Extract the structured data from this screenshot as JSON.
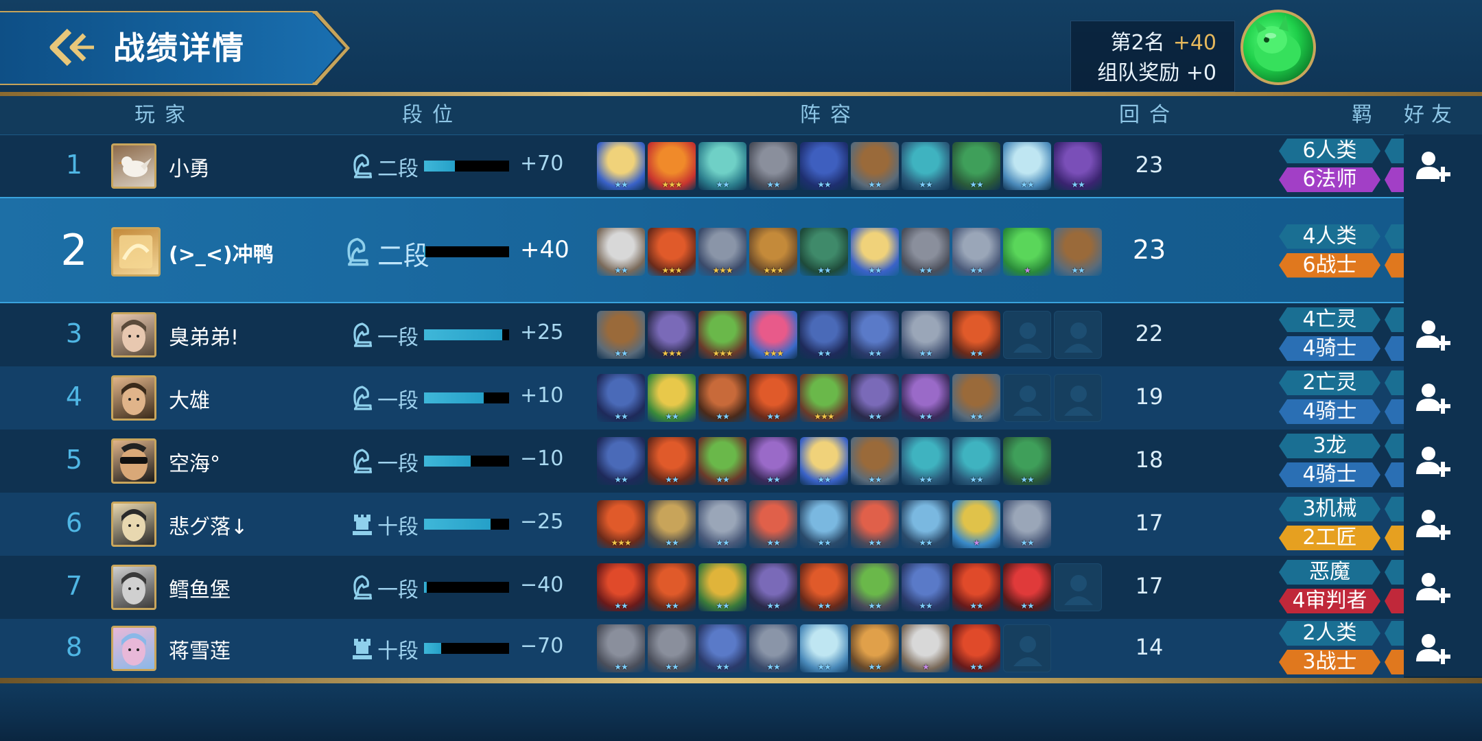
{
  "header": {
    "title": "战绩详情",
    "rank_label": "第2名",
    "rank_points": "+40",
    "team_reward_label": "组队奖励 +0"
  },
  "columns": {
    "player": "玩家",
    "tier": "段位",
    "lineup": "阵容",
    "rounds": "回合",
    "synergy": "羁绊",
    "friends": "好友"
  },
  "colors": {
    "accent_gold": "#c9a65c",
    "rank_blue": "#4fb6e4",
    "synergy_teal": "#1a6f93",
    "synergy_blue": "#2a6fb4",
    "synergy_purple": "#a23fc6",
    "synergy_orange": "#e0781e",
    "synergy_gold": "#e6a020",
    "synergy_red": "#c0283a"
  },
  "players": [
    {
      "rank": "1",
      "name": "小勇",
      "tier_icon": "knight-icon",
      "tier": "二段",
      "tier_progress": 0.36,
      "tier_delta": "+70",
      "rounds": "23",
      "avatar": "dove-avatar",
      "avatar_colors": [
        "#8d6a4a",
        "#d8cfc2"
      ],
      "friend": true,
      "synergies": [
        {
          "label": "6人类",
          "color": "#1a6f93"
        },
        {
          "label": "6法师",
          "color": "#a23fc6"
        }
      ],
      "units": [
        {
          "name": "unit-goddess",
          "stars": 2,
          "colors": [
            "#f0d27a",
            "#3a62c8"
          ]
        },
        {
          "name": "unit-sun-mage",
          "stars": 3,
          "colors": [
            "#f08a2a",
            "#c8352f"
          ]
        },
        {
          "name": "unit-elf-mage",
          "stars": 2,
          "colors": [
            "#6fd0c6",
            "#2b7d8c"
          ]
        },
        {
          "name": "unit-viking",
          "stars": 2,
          "colors": [
            "#8a8f9c",
            "#4a4e5a"
          ]
        },
        {
          "name": "unit-witch",
          "stars": 2,
          "colors": [
            "#3e5fbf",
            "#1e2f70"
          ]
        },
        {
          "name": "unit-cavalry",
          "stars": 2,
          "colors": [
            "#9a6a3a",
            "#5a6b7a"
          ]
        },
        {
          "name": "unit-dragon",
          "stars": 2,
          "colors": [
            "#3fb3c0",
            "#2a5a7a"
          ]
        },
        {
          "name": "unit-goblin-flyer",
          "stars": 2,
          "colors": [
            "#3f9f5a",
            "#2a5a3a"
          ]
        },
        {
          "name": "unit-ice-mage",
          "stars": 2,
          "colors": [
            "#bfe6f2",
            "#4a8aba"
          ]
        },
        {
          "name": "unit-void-mage",
          "stars": 2,
          "colors": [
            "#7a4fb8",
            "#3a2470"
          ]
        }
      ]
    },
    {
      "rank": "2",
      "name": "(>_<)冲鸭",
      "tier_icon": "knight-icon",
      "tier": "二段",
      "tier_progress": 0.02,
      "tier_delta": "+40",
      "rounds": "23",
      "avatar": "gold-avatar",
      "avatar_colors": [
        "#c48a3a",
        "#f3d79a"
      ],
      "friend": false,
      "me": true,
      "synergies": [
        {
          "label": "4人类",
          "color": "#1a6f93"
        },
        {
          "label": "6战士",
          "color": "#e0781e"
        }
      ],
      "units": [
        {
          "name": "unit-old-sage",
          "stars": 2,
          "colors": [
            "#d8d8d8",
            "#7a6a5a"
          ]
        },
        {
          "name": "unit-flame-warrior",
          "stars": 3,
          "colors": [
            "#e05a2a",
            "#6a2a1a"
          ]
        },
        {
          "name": "unit-armored-knight",
          "stars": 3,
          "colors": [
            "#8a95a8",
            "#3a4a6a"
          ]
        },
        {
          "name": "unit-treasure-gate",
          "stars": 3,
          "colors": [
            "#c48a3a",
            "#6a4a2a"
          ]
        },
        {
          "name": "unit-dragon-green",
          "stars": 2,
          "colors": [
            "#3f8a6a",
            "#1e4a3a"
          ]
        },
        {
          "name": "unit-goddess",
          "stars": 2,
          "colors": [
            "#f0d27a",
            "#3a62c8"
          ]
        },
        {
          "name": "unit-viking",
          "stars": 2,
          "colors": [
            "#8a8f9c",
            "#4a4e5a"
          ]
        },
        {
          "name": "unit-axe-knight",
          "stars": 2,
          "colors": [
            "#9aa6b8",
            "#4a5a7a"
          ]
        },
        {
          "name": "unit-green-ogre",
          "stars": 1,
          "colors": [
            "#5ad65a",
            "#2a8a3a"
          ]
        },
        {
          "name": "unit-cavalry",
          "stars": 2,
          "colors": [
            "#9a6a3a",
            "#5a6b7a"
          ]
        }
      ]
    },
    {
      "rank": "3",
      "name": "臭弟弟!",
      "tier_icon": "knight-icon",
      "tier": "一段",
      "tier_progress": 0.92,
      "tier_delta": "+25",
      "rounds": "22",
      "avatar": "portrait-avatar",
      "avatar_colors": [
        "#e8c8b0",
        "#5a4a3a"
      ],
      "friend": true,
      "synergies": [
        {
          "label": "4亡灵",
          "color": "#1a6f93"
        },
        {
          "label": "4骑士",
          "color": "#2a6fb4"
        }
      ],
      "units": [
        {
          "name": "unit-cavalry",
          "stars": 2,
          "colors": [
            "#9a6a3a",
            "#5a6b7a"
          ]
        },
        {
          "name": "unit-reaper",
          "stars": 3,
          "colors": [
            "#7a6ab8",
            "#2a2a4a"
          ]
        },
        {
          "name": "unit-goblin",
          "stars": 3,
          "colors": [
            "#6ab84a",
            "#6a3a2a"
          ]
        },
        {
          "name": "unit-shark",
          "stars": 3,
          "colors": [
            "#e85a8a",
            "#3a6ac8"
          ]
        },
        {
          "name": "unit-death-knight",
          "stars": 2,
          "colors": [
            "#4a6ab8",
            "#1e2a5a"
          ]
        },
        {
          "name": "unit-wraith",
          "stars": 2,
          "colors": [
            "#5a7ac8",
            "#2a3a6a"
          ]
        },
        {
          "name": "unit-axe-knight",
          "stars": 2,
          "colors": [
            "#9aa6b8",
            "#4a5a7a"
          ]
        },
        {
          "name": "unit-flame-warrior",
          "stars": 2,
          "colors": [
            "#e05a2a",
            "#6a2a1a"
          ]
        },
        {
          "name": "empty-slot",
          "stars": 0,
          "empty": true
        },
        {
          "name": "empty-slot",
          "stars": 0,
          "empty": true
        }
      ]
    },
    {
      "rank": "4",
      "name": "大雄",
      "tier_icon": "knight-icon",
      "tier": "一段",
      "tier_progress": 0.7,
      "tier_delta": "+10",
      "rounds": "19",
      "avatar": "portrait-avatar",
      "avatar_colors": [
        "#e0b48a",
        "#3a2a1a"
      ],
      "friend": true,
      "synergies": [
        {
          "label": "2亡灵",
          "color": "#1a6f93"
        },
        {
          "label": "4骑士",
          "color": "#2a6fb4"
        }
      ],
      "units": [
        {
          "name": "unit-death-knight",
          "stars": 2,
          "colors": [
            "#4a6ab8",
            "#1e2a5a"
          ]
        },
        {
          "name": "unit-elf-king",
          "stars": 2,
          "colors": [
            "#e8c84a",
            "#3a8a3a"
          ]
        },
        {
          "name": "unit-troll",
          "stars": 2,
          "colors": [
            "#c86a3a",
            "#4a2a1a"
          ]
        },
        {
          "name": "unit-flame-warrior",
          "stars": 2,
          "colors": [
            "#e05a2a",
            "#6a2a1a"
          ]
        },
        {
          "name": "unit-goblin",
          "stars": 3,
          "colors": [
            "#6ab84a",
            "#6a3a2a"
          ]
        },
        {
          "name": "unit-reaper",
          "stars": 2,
          "colors": [
            "#7a6ab8",
            "#2a2a4a"
          ]
        },
        {
          "name": "unit-witch-purple",
          "stars": 2,
          "colors": [
            "#9a6ac8",
            "#3a2a5a"
          ]
        },
        {
          "name": "unit-cavalry",
          "stars": 2,
          "colors": [
            "#9a6a3a",
            "#5a6b7a"
          ]
        },
        {
          "name": "empty-slot",
          "stars": 0,
          "empty": true
        },
        {
          "name": "empty-slot",
          "stars": 0,
          "empty": true
        }
      ]
    },
    {
      "rank": "5",
      "name": "空海°",
      "tier_icon": "knight-icon",
      "tier": "一段",
      "tier_progress": 0.55,
      "tier_delta": "−10",
      "rounds": "18",
      "avatar": "sunglasses-avatar",
      "avatar_colors": [
        "#e0b48a",
        "#1a1a1a"
      ],
      "friend": true,
      "synergies": [
        {
          "label": "3龙",
          "color": "#1a6f93"
        },
        {
          "label": "4骑士",
          "color": "#2a6fb4"
        }
      ],
      "units": [
        {
          "name": "unit-death-knight",
          "stars": 2,
          "colors": [
            "#4a6ab8",
            "#1e2a5a"
          ]
        },
        {
          "name": "unit-flame-warrior",
          "stars": 2,
          "colors": [
            "#e05a2a",
            "#6a2a1a"
          ]
        },
        {
          "name": "unit-goblin",
          "stars": 2,
          "colors": [
            "#6ab84a",
            "#6a3a2a"
          ]
        },
        {
          "name": "unit-witch-purple",
          "stars": 2,
          "colors": [
            "#9a6ac8",
            "#3a2a5a"
          ]
        },
        {
          "name": "unit-goddess",
          "stars": 2,
          "colors": [
            "#f0d27a",
            "#3a62c8"
          ]
        },
        {
          "name": "unit-cavalry",
          "stars": 2,
          "colors": [
            "#9a6a3a",
            "#5a6b7a"
          ]
        },
        {
          "name": "unit-dragon",
          "stars": 2,
          "colors": [
            "#3fb3c0",
            "#2a5a7a"
          ]
        },
        {
          "name": "unit-dragon",
          "stars": 2,
          "colors": [
            "#3fb3c0",
            "#2a5a7a"
          ]
        },
        {
          "name": "unit-goblin-flyer",
          "stars": 2,
          "colors": [
            "#3f9f5a",
            "#2a5a3a"
          ]
        },
        {
          "name": "empty-slot",
          "stars": 0,
          "hidden": true
        }
      ]
    },
    {
      "rank": "6",
      "name": "悲グ落↓",
      "tier_icon": "rook-icon",
      "tier": "十段",
      "tier_progress": 0.78,
      "tier_delta": "−25",
      "rounds": "17",
      "avatar": "portrait-avatar",
      "avatar_colors": [
        "#e8d8b0",
        "#2a2a2a"
      ],
      "friend": true,
      "synergies": [
        {
          "label": "3机械",
          "color": "#1a6f93"
        },
        {
          "label": "2工匠",
          "color": "#e6a020"
        }
      ],
      "units": [
        {
          "name": "unit-flame-warrior",
          "stars": 3,
          "colors": [
            "#e05a2a",
            "#6a2a1a"
          ]
        },
        {
          "name": "unit-mech-golem",
          "stars": 2,
          "colors": [
            "#c8a45a",
            "#4a4a4a"
          ]
        },
        {
          "name": "unit-axe-knight",
          "stars": 2,
          "colors": [
            "#9aa6b8",
            "#4a5a7a"
          ]
        },
        {
          "name": "unit-bomber",
          "stars": 2,
          "colors": [
            "#e0604a",
            "#4a4a5a"
          ]
        },
        {
          "name": "unit-blade-knight",
          "stars": 2,
          "colors": [
            "#7ab8e0",
            "#2a4a6a"
          ]
        },
        {
          "name": "unit-bomber",
          "stars": 2,
          "colors": [
            "#e0604a",
            "#4a4a5a"
          ]
        },
        {
          "name": "unit-blade-knight",
          "stars": 2,
          "colors": [
            "#7ab8e0",
            "#2a4a6a"
          ]
        },
        {
          "name": "unit-helicopter",
          "stars": 1,
          "colors": [
            "#e0c24a",
            "#3a8ac8"
          ]
        },
        {
          "name": "unit-axe-knight",
          "stars": 2,
          "colors": [
            "#9aa6b8",
            "#4a5a7a"
          ]
        },
        {
          "name": "empty-slot",
          "stars": 0,
          "hidden": true
        }
      ]
    },
    {
      "rank": "7",
      "name": "鳕鱼堡",
      "tier_icon": "knight-icon",
      "tier": "一段",
      "tier_progress": 0.03,
      "tier_delta": "−40",
      "rounds": "17",
      "avatar": "portrait-avatar",
      "avatar_colors": [
        "#d0d0d0",
        "#3a3a3a"
      ],
      "friend": true,
      "synergies": [
        {
          "label": "恶魔",
          "color": "#1a6f93"
        },
        {
          "label": "4审判者",
          "color": "#c0283a"
        }
      ],
      "units": [
        {
          "name": "unit-fire-demon",
          "stars": 2,
          "colors": [
            "#e04a2a",
            "#6a1a1a"
          ]
        },
        {
          "name": "unit-flame-warrior",
          "stars": 2,
          "colors": [
            "#e05a2a",
            "#6a2a1a"
          ]
        },
        {
          "name": "unit-tribal-chief",
          "stars": 2,
          "colors": [
            "#e0b43a",
            "#3a7a3a"
          ]
        },
        {
          "name": "unit-reaper",
          "stars": 2,
          "colors": [
            "#7a6ab8",
            "#2a2a4a"
          ]
        },
        {
          "name": "unit-flame-warrior",
          "stars": 2,
          "colors": [
            "#e05a2a",
            "#6a2a1a"
          ]
        },
        {
          "name": "unit-goblin-gunner",
          "stars": 2,
          "colors": [
            "#6ab84a",
            "#4a4a5a"
          ]
        },
        {
          "name": "unit-wraith",
          "stars": 2,
          "colors": [
            "#5a7ac8",
            "#2a3a6a"
          ]
        },
        {
          "name": "unit-fire-demon",
          "stars": 2,
          "colors": [
            "#e04a2a",
            "#6a1a1a"
          ]
        },
        {
          "name": "unit-red-demon",
          "stars": 2,
          "colors": [
            "#e03a3a",
            "#5a1a1a"
          ]
        },
        {
          "name": "empty-slot",
          "stars": 0,
          "empty": true
        }
      ]
    },
    {
      "rank": "8",
      "name": "蒋雪莲",
      "tier_icon": "rook-icon",
      "tier": "十段",
      "tier_progress": 0.2,
      "tier_delta": "−70",
      "rounds": "14",
      "avatar": "portrait-avatar",
      "avatar_colors": [
        "#e8b8d8",
        "#8ab8e8"
      ],
      "friend": true,
      "synergies": [
        {
          "label": "2人类",
          "color": "#1a6f93"
        },
        {
          "label": "3战士",
          "color": "#e0781e"
        }
      ],
      "units": [
        {
          "name": "unit-viking",
          "stars": 2,
          "colors": [
            "#8a8f9c",
            "#4a4e5a"
          ]
        },
        {
          "name": "unit-viking",
          "stars": 2,
          "colors": [
            "#8a8f9c",
            "#4a4e5a"
          ]
        },
        {
          "name": "unit-wraith",
          "stars": 2,
          "colors": [
            "#5a7ac8",
            "#2a3a6a"
          ]
        },
        {
          "name": "unit-armored-knight",
          "stars": 2,
          "colors": [
            "#8a95a8",
            "#3a4a6a"
          ]
        },
        {
          "name": "unit-ice-mage",
          "stars": 2,
          "colors": [
            "#bfe6f2",
            "#4a8aba"
          ]
        },
        {
          "name": "unit-beast-warrior",
          "stars": 2,
          "colors": [
            "#e0a04a",
            "#6a4a2a"
          ]
        },
        {
          "name": "unit-old-sage",
          "stars": 1,
          "colors": [
            "#d8d8d8",
            "#7a6a5a"
          ]
        },
        {
          "name": "unit-fire-demon",
          "stars": 2,
          "colors": [
            "#e04a2a",
            "#6a1a1a"
          ]
        },
        {
          "name": "empty-slot",
          "stars": 0,
          "empty": true
        },
        {
          "name": "empty-slot",
          "stars": 0,
          "hidden": true
        }
      ]
    }
  ]
}
